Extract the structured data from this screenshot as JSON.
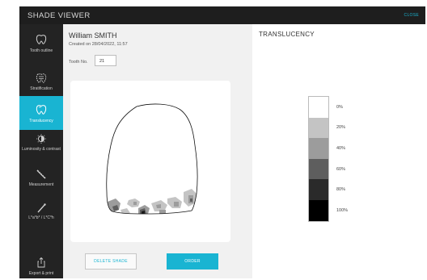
{
  "app": {
    "title": "SHADE VIEWER",
    "close_label": "CLOSE"
  },
  "sidebar": {
    "items": [
      {
        "label": "Tooth outline",
        "icon": "tooth-outline-icon",
        "active": false
      },
      {
        "label": "Stratification",
        "icon": "stratification-icon",
        "active": false
      },
      {
        "label": "Translucency",
        "icon": "translucency-icon",
        "active": true
      },
      {
        "label": "Luminosity & contrast",
        "icon": "luminosity-icon",
        "active": false
      },
      {
        "label": "Measurement",
        "icon": "measurement-icon",
        "active": false
      },
      {
        "label": "L*a*b* / L*C*h",
        "icon": "lab-icon",
        "active": false
      },
      {
        "label": "Export & print",
        "icon": "export-icon",
        "active": false
      }
    ]
  },
  "patient": {
    "name": "William SMITH",
    "created": "Created on 28/04/2022, 11:57",
    "tooth_label": "Tooth No.",
    "tooth_number": "21"
  },
  "actions": {
    "delete_label": "DELETE SHADE",
    "order_label": "ORDER"
  },
  "translucency": {
    "title": "TRANSLUCENCY",
    "scale": [
      {
        "label": "0%",
        "color": "#ffffff"
      },
      {
        "label": "20%",
        "color": "#c4c4c4"
      },
      {
        "label": "40%",
        "color": "#9c9c9c"
      },
      {
        "label": "60%",
        "color": "#5e5e5e"
      },
      {
        "label": "80%",
        "color": "#2a2a2a"
      },
      {
        "label": "100%",
        "color": "#000000"
      }
    ]
  },
  "colors": {
    "accent": "#19b4d2",
    "sidebar_bg": "#232323",
    "topbar_bg": "#1e1e1e"
  }
}
